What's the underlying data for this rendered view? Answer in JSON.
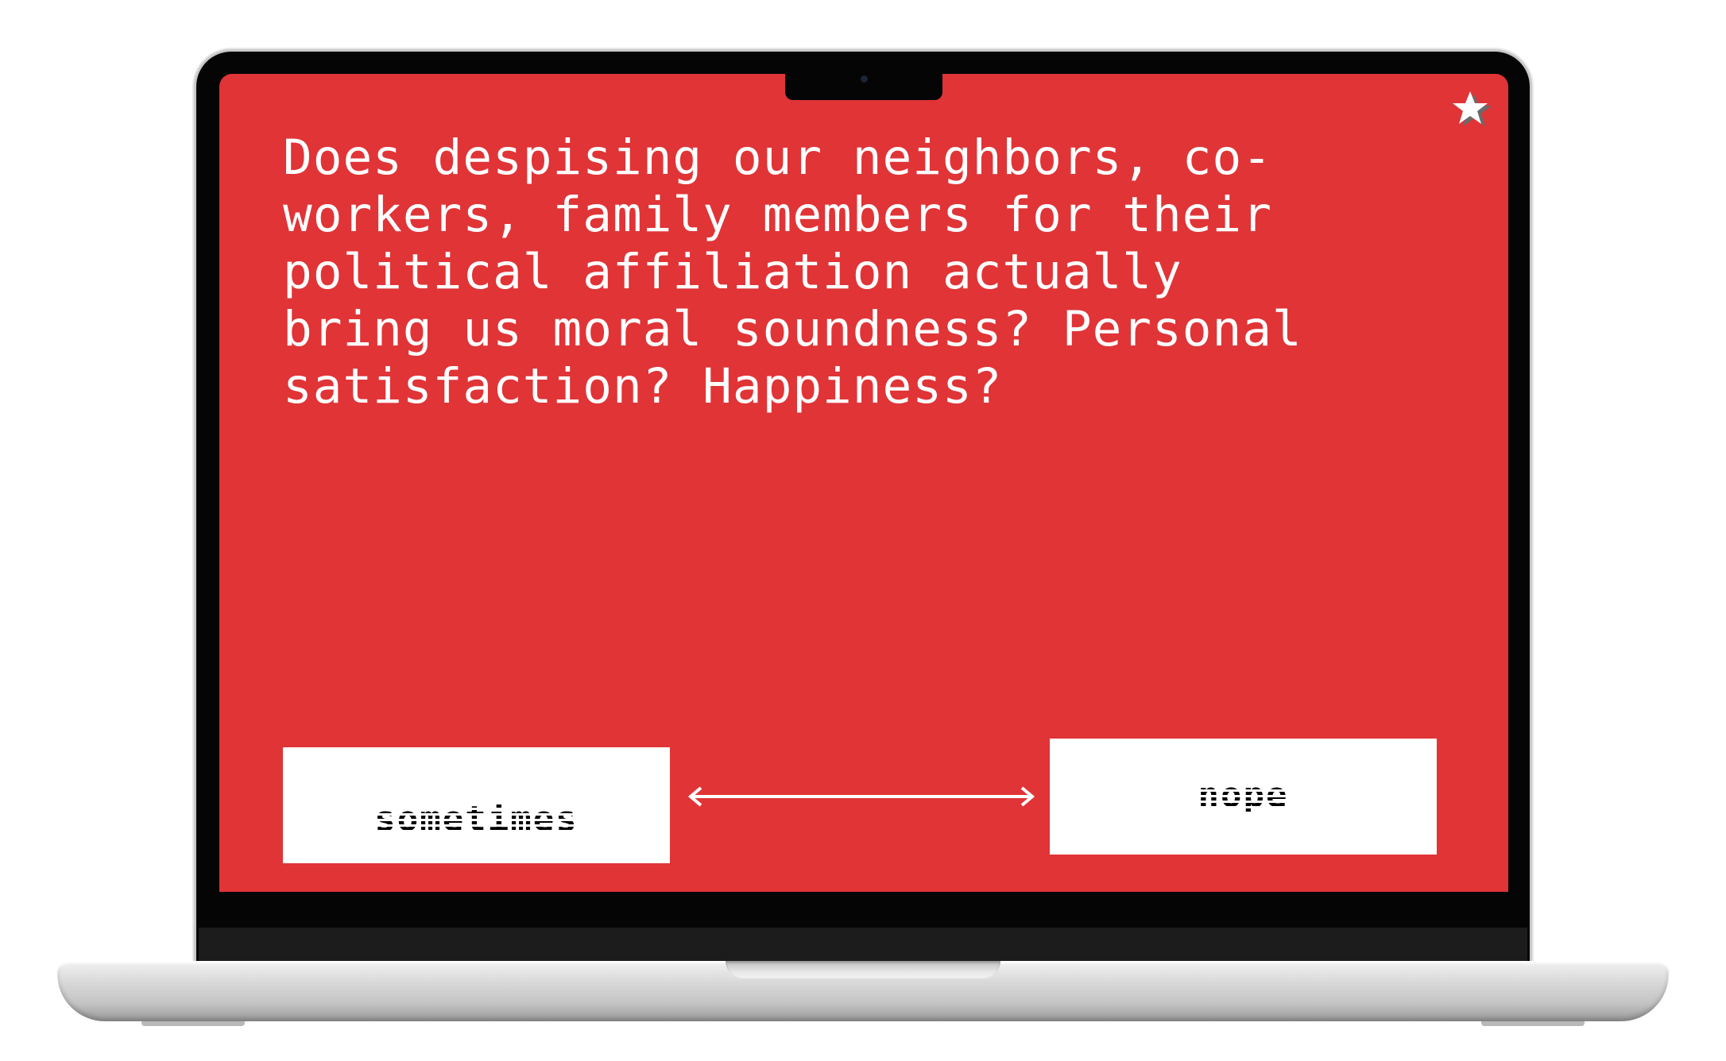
{
  "card": {
    "question": "Does despising our neighbors, co-workers, family members for their political affiliation actually bring us moral soundness? Personal satisfaction? Happiness?"
  },
  "answers": {
    "left_label": "sometimes",
    "right_label": "nope"
  },
  "icons": {
    "favorite": "star-icon",
    "scale": "double-arrow-icon"
  },
  "colors": {
    "screen_background": "#e03437",
    "text": "#ffffff",
    "button_background": "#ffffff",
    "button_text": "#000000"
  }
}
